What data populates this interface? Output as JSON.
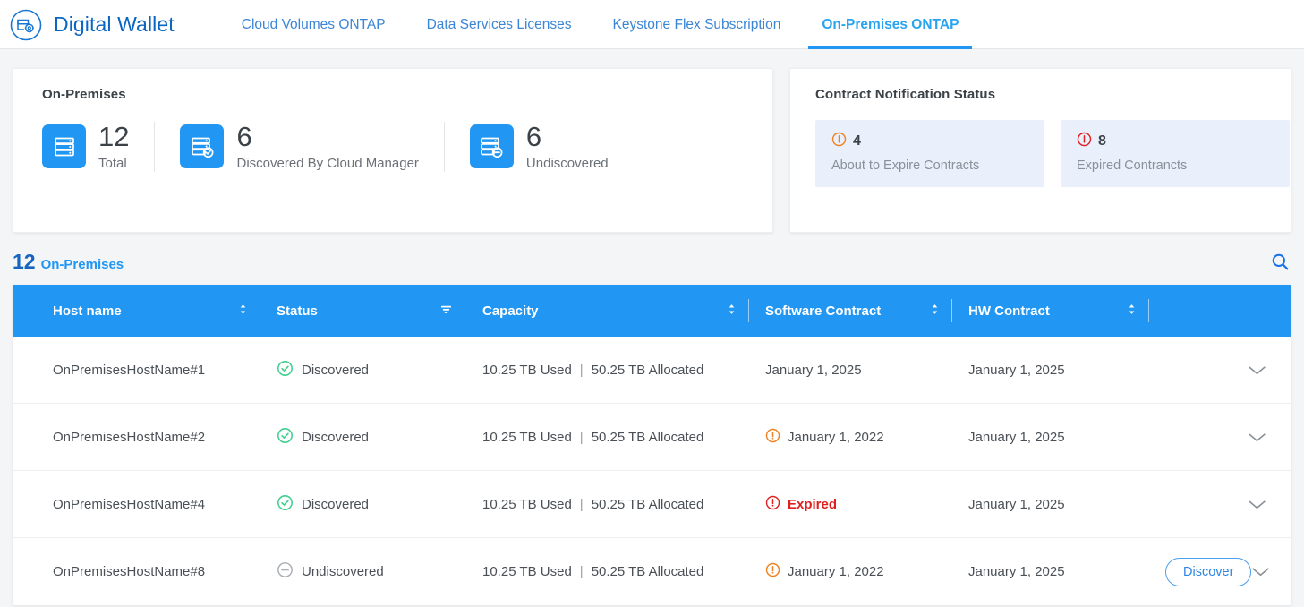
{
  "header": {
    "logo_icon": "digital-wallet-icon",
    "title": "Digital Wallet",
    "tabs": [
      {
        "label": "Cloud Volumes ONTAP",
        "active": false
      },
      {
        "label": "Data Services Licenses",
        "active": false
      },
      {
        "label": "Keystone Flex Subscription",
        "active": false
      },
      {
        "label": "On-Premises ONTAP",
        "active": true
      }
    ]
  },
  "summary_card": {
    "title": "On-Premises",
    "stats": [
      {
        "icon": "server-stack-icon",
        "value": "12",
        "label": "Total"
      },
      {
        "icon": "server-stack-check-icon",
        "value": "6",
        "label": "Discovered By Cloud Manager"
      },
      {
        "icon": "server-stack-minus-icon",
        "value": "6",
        "label": "Undiscovered"
      }
    ]
  },
  "contract_card": {
    "title": "Contract Notification Status",
    "items": [
      {
        "icon": "warning-circle-icon",
        "count": "4",
        "label": "About to Expire Contracts",
        "color": "#f08020"
      },
      {
        "icon": "error-circle-icon",
        "count": "8",
        "label": "Expired Contrancts",
        "color": "#e02020"
      }
    ]
  },
  "table_toolbar": {
    "count": "12",
    "count_label": "On-Premises",
    "search_icon": "search-icon"
  },
  "table": {
    "columns": [
      {
        "label": "Host name",
        "control": "sort"
      },
      {
        "label": "Status",
        "control": "filter"
      },
      {
        "label": "Capacity",
        "control": "sort"
      },
      {
        "label": "Software Contract",
        "control": "sort"
      },
      {
        "label": "HW Contract",
        "control": "sort"
      },
      {
        "label": "",
        "control": "none"
      }
    ],
    "rows": [
      {
        "host": "OnPremisesHostName#1",
        "status": "Discovered",
        "status_icon": "check-circle-icon",
        "capacity_used": "10.25 TB Used",
        "capacity_allocated": "50.25 TB Allocated",
        "capacity_separator": "|",
        "software_contract": "January 1, 2025",
        "software_state": "ok",
        "hw_contract": "January 1, 2025",
        "action": "",
        "expand_icon": "chevron-down-icon"
      },
      {
        "host": "OnPremisesHostName#2",
        "status": "Discovered",
        "status_icon": "check-circle-icon",
        "capacity_used": "10.25 TB Used",
        "capacity_allocated": "50.25 TB Allocated",
        "capacity_separator": "|",
        "software_contract": "January 1, 2022",
        "software_state": "warning",
        "hw_contract": "January 1, 2025",
        "action": "",
        "expand_icon": "chevron-down-icon"
      },
      {
        "host": "OnPremisesHostName#4",
        "status": "Discovered",
        "status_icon": "check-circle-icon",
        "capacity_used": "10.25 TB Used",
        "capacity_allocated": "50.25 TB Allocated",
        "capacity_separator": "|",
        "software_contract": "Expired",
        "software_state": "expired",
        "hw_contract": "January 1, 2025",
        "action": "",
        "expand_icon": "chevron-down-icon"
      },
      {
        "host": "OnPremisesHostName#8",
        "status": "Undiscovered",
        "status_icon": "minus-circle-icon",
        "capacity_used": "10.25 TB Used",
        "capacity_allocated": "50.25 TB Allocated",
        "capacity_separator": "|",
        "software_contract": "January 1, 2022",
        "software_state": "warning",
        "hw_contract": "January 1, 2025",
        "action": "Discover",
        "expand_icon": "chevron-down-icon"
      }
    ]
  },
  "colors": {
    "accent_blue": "#2196f3",
    "link_blue": "#3b85d6",
    "warning_orange": "#f08020",
    "error_red": "#e02020",
    "success_green": "#3fcf8e",
    "muted_gray": "#8a9098"
  }
}
